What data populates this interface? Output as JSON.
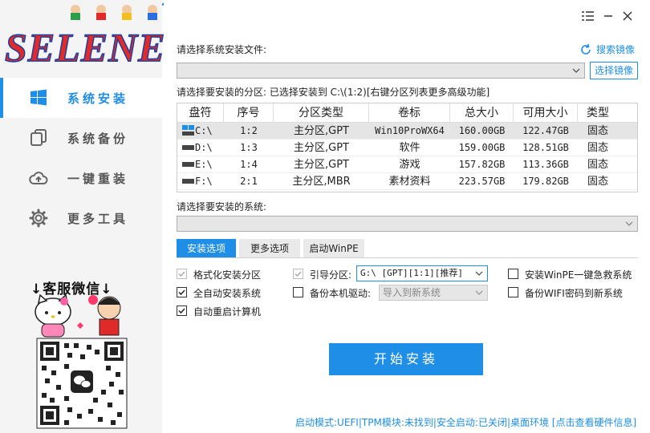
{
  "app": {
    "logo_text": "SELENE"
  },
  "colors": {
    "accent": "#1e8ee6",
    "sidebar_bg": "#f4f4f4"
  },
  "sidebar": {
    "items": [
      {
        "label": "系统安装",
        "icon": "windows-icon",
        "active": true
      },
      {
        "label": "系统备份",
        "icon": "copy-icon",
        "active": false
      },
      {
        "label": "一键重装",
        "icon": "cloud-icon",
        "active": false
      },
      {
        "label": "更多工具",
        "icon": "gear-icon",
        "active": false
      }
    ],
    "support": {
      "title": "↓客服微信↓"
    }
  },
  "titlebar": {
    "menu_icon": "menu-icon",
    "minimize_icon": "minimize-icon",
    "close_icon": "close-icon"
  },
  "install_file": {
    "label": "请选择系统安装文件:",
    "search_label": "搜索镜像",
    "value": "",
    "select_button": "选择镜像"
  },
  "partition": {
    "label": "请选择要安装的分区: 已选择安装到 C:\\(1:2)[右键分区列表更多高级功能]",
    "columns": [
      "盘符",
      "序号",
      "分区类型",
      "卷标",
      "总大小",
      "可用大小",
      "类型"
    ],
    "rows": [
      [
        "C:\\",
        "1:2",
        "主分区,GPT",
        "Win10ProWX64",
        "160.00GB",
        "122.47GB",
        "固态"
      ],
      [
        "D:\\",
        "1:3",
        "主分区,GPT",
        "软件",
        "159.00GB",
        "128.51GB",
        "固态"
      ],
      [
        "E:\\",
        "1:4",
        "主分区,GPT",
        "游戏",
        "157.82GB",
        "113.36GB",
        "固态"
      ],
      [
        "F:\\",
        "2:1",
        "主分区,MBR",
        "素材资料",
        "223.57GB",
        "179.82GB",
        "固态"
      ]
    ]
  },
  "system": {
    "label": "请选择要安装的系统:",
    "value": ""
  },
  "tabs": [
    "安装选项",
    "更多选项",
    "启动WinPE"
  ],
  "options": {
    "format_partition": {
      "label": "格式化安装分区",
      "checked": true,
      "disabled": true
    },
    "auto_install": {
      "label": "全自动安装系统",
      "checked": true,
      "disabled": false
    },
    "auto_reboot": {
      "label": "自动重启计算机",
      "checked": true,
      "disabled": false
    },
    "boot_partition": {
      "label": "引导分区:",
      "checked": true,
      "disabled": true,
      "value": "G:\\ [GPT][1:1][推荐]"
    },
    "backup_driver": {
      "label": "备份本机驱动:",
      "checked": false,
      "disabled": false,
      "value": "导入到新系统"
    },
    "install_winpe": {
      "label": "安装WinPE一键急救系统",
      "checked": false
    },
    "backup_wifi": {
      "label": "备份WIFI密码到新系统",
      "checked": false
    }
  },
  "start_button": "开始安装",
  "status": "启动模式:UEFI|TPM模块:未找到|安全启动:已关闭|桌面环境 [点击查看硬件信息]"
}
